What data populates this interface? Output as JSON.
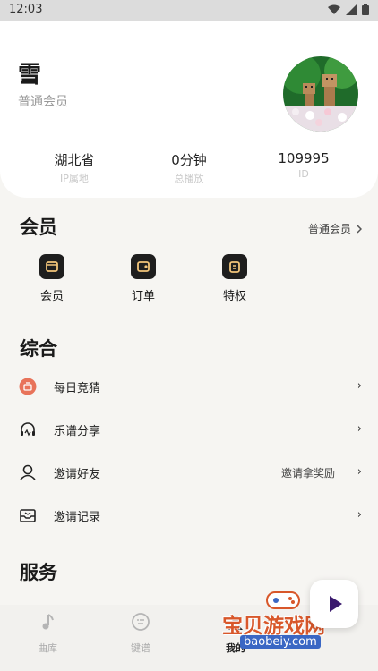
{
  "status_bar": {
    "time": "12:03"
  },
  "profile": {
    "name": "雪",
    "member_type": "普通会员",
    "stats": [
      {
        "value": "湖北省",
        "label": "IP属地"
      },
      {
        "value": "0分钟",
        "label": "总播放"
      },
      {
        "value": "109995",
        "label": "ID"
      }
    ]
  },
  "membership": {
    "title": "会员",
    "right_label": "普通会员",
    "items": [
      {
        "label": "会员",
        "icon": "wallet-icon"
      },
      {
        "label": "订单",
        "icon": "order-icon"
      },
      {
        "label": "特权",
        "icon": "privilege-icon"
      }
    ]
  },
  "general": {
    "title": "综合",
    "items": [
      {
        "label": "每日竞猜",
        "right": "",
        "icon": "quiz-icon"
      },
      {
        "label": "乐谱分享",
        "right": "",
        "icon": "headphones-icon"
      },
      {
        "label": "邀请好友",
        "right": "邀请拿奖励",
        "icon": "user-icon"
      },
      {
        "label": "邀请记录",
        "right": "",
        "icon": "inbox-icon"
      }
    ]
  },
  "service": {
    "title": "服务"
  },
  "tabbar": {
    "tabs": [
      {
        "label": "曲库",
        "icon": "music-note-icon"
      },
      {
        "label": "键谱",
        "icon": "keypad-icon"
      },
      {
        "label": "我的",
        "icon": "profile-icon"
      }
    ]
  },
  "watermark": {
    "line1": "宝贝游戏网",
    "line2": "baobeiy.com"
  },
  "colors": {
    "accent": "#1e1e1e",
    "quiz_icon": "#e8735a",
    "fab_play": "#3b1a6e"
  }
}
